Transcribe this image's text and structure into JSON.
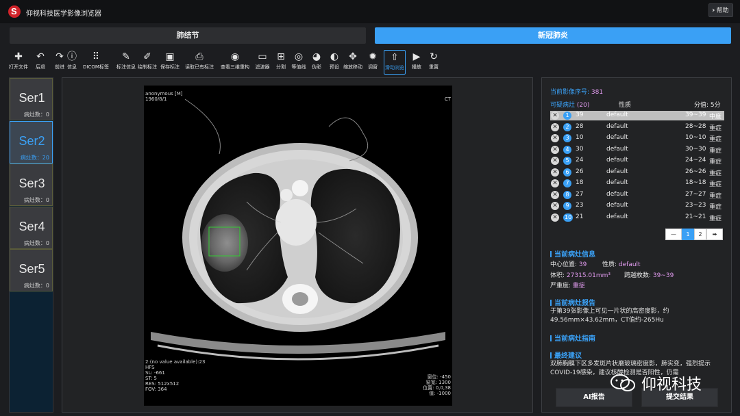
{
  "app": {
    "title": "仰视科技医学影像浏览器",
    "help_label": "帮助"
  },
  "modes": {
    "nodule": "肺结节",
    "covid": "新冠肺炎"
  },
  "toolbar": [
    {
      "icon": "plus-icon",
      "glyph": "✚",
      "label": "打开文件"
    },
    {
      "icon": "undo-icon",
      "glyph": "↶",
      "label": "后退"
    },
    {
      "icon": "redo-icon",
      "glyph": "↷",
      "label": "前进"
    },
    {
      "icon": "info-icon",
      "glyph": "ⓘ",
      "label": "信息"
    },
    {
      "icon": "grid-icon",
      "glyph": "⠿",
      "label": "DICOM标签"
    },
    {
      "icon": "pencil-icon",
      "glyph": "✎",
      "label": "标注信息"
    },
    {
      "icon": "draw-annotation-icon",
      "glyph": "✐",
      "label": "绘制标注"
    },
    {
      "icon": "save-icon",
      "glyph": "▣",
      "label": "保存标注"
    },
    {
      "icon": "load-annotation-icon",
      "glyph": "⎙",
      "label": "读取已有标注"
    },
    {
      "icon": "eye-icon",
      "glyph": "◉",
      "label": "查看三维重构"
    },
    {
      "icon": "filter-icon",
      "glyph": "▭",
      "label": "滤波器"
    },
    {
      "icon": "split-icon",
      "glyph": "⊞",
      "label": "分割"
    },
    {
      "icon": "contour-icon",
      "glyph": "◎",
      "label": "等值线"
    },
    {
      "icon": "pseudo-color-icon",
      "glyph": "◕",
      "label": "伪彩"
    },
    {
      "icon": "preset-icon",
      "glyph": "◐",
      "label": "预设"
    },
    {
      "icon": "move-icon",
      "glyph": "✥",
      "label": "缩放移动"
    },
    {
      "icon": "brightness-icon",
      "glyph": "✹",
      "label": "调窗"
    },
    {
      "icon": "scroll-icon",
      "glyph": "⇧",
      "label": "滑动浏览"
    },
    {
      "icon": "play-icon",
      "glyph": "▶",
      "label": "播放"
    },
    {
      "icon": "reset-icon",
      "glyph": "↻",
      "label": "重置"
    }
  ],
  "series": [
    {
      "name": "Ser1",
      "count_label": "病灶数：0"
    },
    {
      "name": "Ser2",
      "count_label": "病灶数：20"
    },
    {
      "name": "Ser3",
      "count_label": "病灶数：0"
    },
    {
      "name": "Ser4",
      "count_label": "病灶数：0"
    },
    {
      "name": "Ser5",
      "count_label": "病灶数：0"
    }
  ],
  "viewer": {
    "top_left": [
      "anonymous [M]",
      "1960/8/1"
    ],
    "top_right": "CT",
    "bottom_left": [
      "2:(no value available):23",
      "HFS",
      "SL: -661",
      "ST: 5",
      "RES: 512x512",
      "FOV: 364"
    ],
    "bottom_right": [
      "窗位: -450",
      "窗宽: 1300",
      "位置: 0,0,38",
      "值: -1000"
    ]
  },
  "info": {
    "series_label": "当前影像序号:",
    "series_value": "381",
    "suspect_label": "可疑病灶",
    "suspect_count": "(20)",
    "nature_header": "性质",
    "score_label": "分值: 5分",
    "lesions": [
      {
        "num": "1",
        "slice": "39",
        "nature": "default",
        "range": "39~39",
        "severity": "中度"
      },
      {
        "num": "2",
        "slice": "28",
        "nature": "default",
        "range": "28~28",
        "severity": "重症"
      },
      {
        "num": "3",
        "slice": "10",
        "nature": "default",
        "range": "10~10",
        "severity": "重症"
      },
      {
        "num": "4",
        "slice": "30",
        "nature": "default",
        "range": "30~30",
        "severity": "重症"
      },
      {
        "num": "5",
        "slice": "24",
        "nature": "default",
        "range": "24~24",
        "severity": "重症"
      },
      {
        "num": "6",
        "slice": "26",
        "nature": "default",
        "range": "26~26",
        "severity": "重症"
      },
      {
        "num": "7",
        "slice": "18",
        "nature": "default",
        "range": "18~18",
        "severity": "重症"
      },
      {
        "num": "8",
        "slice": "27",
        "nature": "default",
        "range": "27~27",
        "severity": "重症"
      },
      {
        "num": "9",
        "slice": "23",
        "nature": "default",
        "range": "23~23",
        "severity": "重症"
      },
      {
        "num": "10",
        "slice": "21",
        "nature": "default",
        "range": "21~21",
        "severity": "重症"
      }
    ],
    "pager": {
      "first": "—",
      "page1": "1",
      "page2": "2",
      "next": "➡"
    },
    "current_title": "当前病灶信息",
    "center_label": "中心位置:",
    "center_value": "39",
    "nature_label": "性质:",
    "nature_value": "default",
    "volume_label": "体积:",
    "volume_value": "27315.01mm³",
    "span_label": "跨越枚数:",
    "span_value": "39~39",
    "severity_label": "严重度:",
    "severity_value": "重症",
    "report_title": "当前病灶报告",
    "report_text": "于第39张影像上可见一片状的高密度影，约49.56mm×43.62mm，CT值约-265Hu",
    "guide_title": "当前病灶指南",
    "final_title": "最终建议",
    "final_text": "双肺胸膜下区多发斑片状磨玻璃密度影，肺实变，强烈提示COVID-19感染，建议核酸检测是否阳性，仍需",
    "ai_report_label": "AI报告",
    "submit_label": "提交结果"
  },
  "watermark": {
    "text": "仰视科技"
  },
  "colors": {
    "accent": "#3aa0f5",
    "pink": "#e39cf1",
    "roi": "#33cc33"
  }
}
